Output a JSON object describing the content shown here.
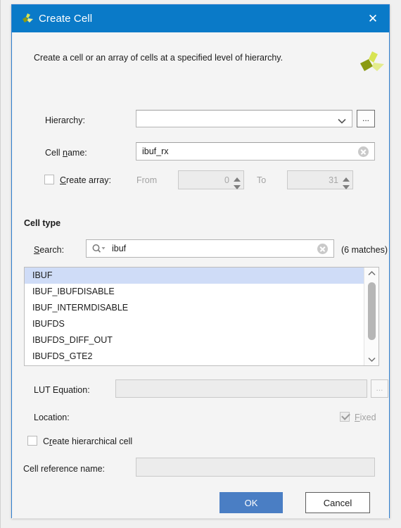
{
  "window": {
    "title": "Create Cell",
    "logo_icon": "vivado-logo-icon",
    "close_icon": "close-icon"
  },
  "header": {
    "description": "Create a cell or an array of cells at a specified level of hierarchy.",
    "logo_icon": "vivado-logo-large-icon"
  },
  "form": {
    "hierarchy": {
      "label": "Hierarchy:",
      "value": "",
      "browse_label": "...",
      "dropdown_icon": "chevron-down-icon"
    },
    "cell_name": {
      "label_pre": "Cell ",
      "label_mnemonic": "n",
      "label_post": "ame:",
      "value": "ibuf_rx",
      "clear_icon": "clear-circle-icon"
    },
    "create_array": {
      "label_pre": "",
      "label_mnemonic": "C",
      "label_post": "reate array:",
      "checked": false,
      "from_label": "From",
      "from_value": "0",
      "to_label": "To",
      "to_value": "31"
    }
  },
  "cell_type": {
    "title": "Cell type",
    "search": {
      "label_mnemonic": "S",
      "label_post": "earch:",
      "value": "ibuf",
      "search_icon": "search-dropdown-icon",
      "clear_icon": "clear-circle-icon",
      "matches": "(6 matches)"
    },
    "list": [
      {
        "label": "IBUF",
        "selected": true
      },
      {
        "label": "IBUF_IBUFDISABLE",
        "selected": false
      },
      {
        "label": "IBUF_INTERMDISABLE",
        "selected": false
      },
      {
        "label": "IBUFDS",
        "selected": false
      },
      {
        "label": "IBUFDS_DIFF_OUT",
        "selected": false
      },
      {
        "label": "IBUFDS_GTE2",
        "selected": false
      }
    ],
    "scroll_up_icon": "chevron-up-icon",
    "scroll_down_icon": "chevron-down-icon"
  },
  "lut": {
    "label": "LUT Equation:",
    "value": "",
    "browse_label": "..."
  },
  "location": {
    "label": "Location:",
    "fixed_mnemonic": "F",
    "fixed_post": "ixed",
    "checked": true
  },
  "hierarchical": {
    "label_pre": "C",
    "label_mnemonic": "r",
    "label_post": "eate hierarchical cell",
    "checked": false
  },
  "cell_reference": {
    "label": "Cell reference name:",
    "value": ""
  },
  "buttons": {
    "ok": "OK",
    "cancel": "Cancel"
  },
  "colors": {
    "titlebar": "#0a7ac8",
    "primary_button": "#4a7ec4",
    "selection": "#cfdcf7",
    "logo_light": "#cede4a",
    "logo_dark": "#8a9a12"
  }
}
